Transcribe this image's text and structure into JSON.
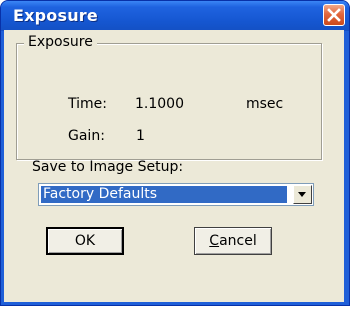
{
  "window": {
    "title": "Exposure",
    "close_icon": "close-icon",
    "title_bar_color": "#1f5fd8",
    "close_button_color": "#e2673d"
  },
  "group": {
    "legend": "Exposure",
    "time_label": "Time:",
    "time_value": "1.1000",
    "time_unit": "msec",
    "gain_label": "Gain:",
    "gain_value": "1"
  },
  "save_setup": {
    "label": "Save to Image Setup:",
    "selected": "Factory Defaults",
    "dropdown_icon": "chevron-down-icon"
  },
  "buttons": {
    "ok": "OK",
    "cancel_mnemonic": "C",
    "cancel_rest": "ancel"
  }
}
